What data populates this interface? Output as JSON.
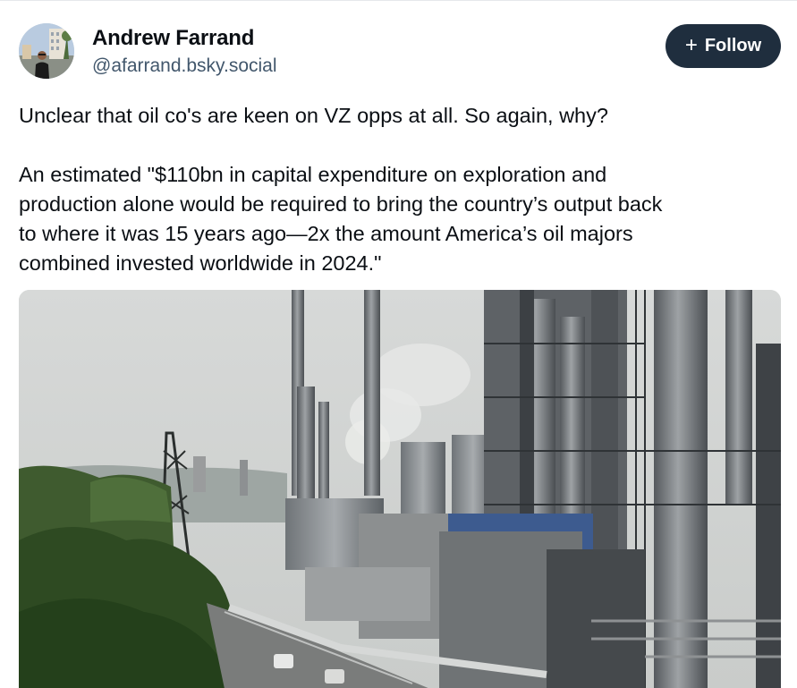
{
  "author": {
    "name": "Andrew Farrand",
    "handle": "@afarrand.bsky.social"
  },
  "follow_button": {
    "icon": "plus-icon",
    "label": "Follow"
  },
  "post": {
    "paragraph_1": "Unclear that oil co's are keen on VZ opps at all. So again, why?",
    "paragraph_2_lines": [
      "An estimated \"$110bn in capital expenditure on exploration and",
      "production alone would be required to bring the country’s output back",
      "to where it was 15 years ago—2x the amount America’s oil majors",
      "combined invested worldwide in 2024.\""
    ]
  },
  "media": {
    "type": "photo",
    "subject": "oil-refinery-photo"
  },
  "colors": {
    "follow_bg": "#1f2e3e",
    "handle": "#42576c",
    "text": "#0b0f14"
  }
}
